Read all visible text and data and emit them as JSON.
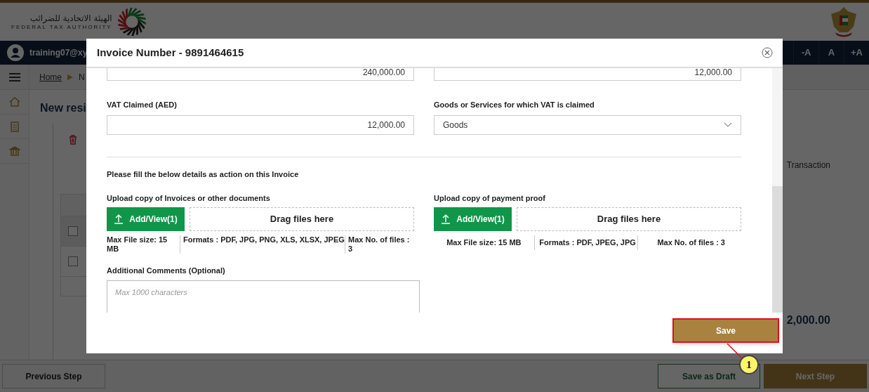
{
  "header": {
    "org_name_ar": "الهيئة الاتحادية للضرائب",
    "org_name_en": "FEDERAL TAX AUTHORITY"
  },
  "top_bar": {
    "user": "training07@xy",
    "font_buttons": [
      "-A",
      "A",
      "+A"
    ]
  },
  "breadcrumb": [
    "Home",
    "N"
  ],
  "page": {
    "title": "New resi",
    "column_header": "Transaction",
    "total": "2,000.00",
    "rows": [
      {
        "checked": false
      },
      {
        "checked": false
      }
    ]
  },
  "footer_buttons": [
    {
      "label": "Previous Step",
      "kind": "secondary"
    },
    {
      "label": "Save as Draft",
      "kind": "outline"
    },
    {
      "label": "Next Step",
      "kind": "primary"
    }
  ],
  "modal": {
    "title": "Invoice Number - 9891464615",
    "top_fields": [
      {
        "value": "240,000.00"
      },
      {
        "value": "12,000.00"
      }
    ],
    "vat_claimed": {
      "label": "VAT Claimed (AED)",
      "value": "12,000.00"
    },
    "goods_services": {
      "label": "Goods or Services for which VAT is claimed",
      "value": "Goods"
    },
    "instruction": "Please fill the below details as action on this Invoice",
    "uploads": [
      {
        "label": "Upload copy of Invoices or other documents",
        "button": "Add/View(1)",
        "dropzone": "Drag files here",
        "info": [
          "Max File size: 15 MB",
          "Formats : PDF, JPG, PNG, XLS, XLSX, JPEG",
          "Max No. of files : 3"
        ],
        "wrap": true
      },
      {
        "label": "Upload copy of payment proof",
        "button": "Add/View(1)",
        "dropzone": "Drag files here",
        "info": [
          "Max File size: 15 MB",
          "Formats : PDF, JPEG, JPG",
          "Max No. of files : 3"
        ],
        "wrap": false
      }
    ],
    "comments": {
      "label": "Additional Comments (Optional)",
      "placeholder": "Max 1000 characters"
    },
    "save_button": "Save"
  },
  "callout": {
    "number": "1"
  }
}
